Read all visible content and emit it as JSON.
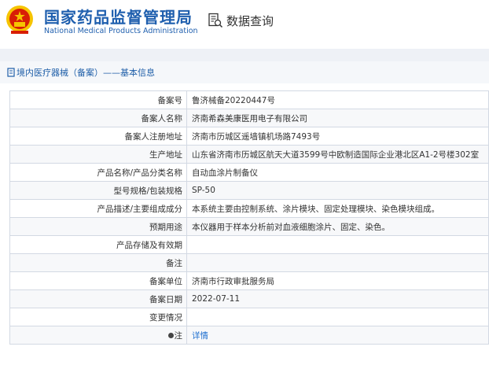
{
  "header": {
    "org_name_cn": "国家药品监督管理局",
    "org_name_en": "National Medical Products Administration",
    "search_title": "数据查询"
  },
  "breadcrumb": {
    "text": "境内医疗器械（备案）——基本信息"
  },
  "record": {
    "rows": [
      {
        "label": "备案号",
        "value": "鲁济械备20220447号"
      },
      {
        "label": "备案人名称",
        "value": "济南希森美康医用电子有限公司"
      },
      {
        "label": "备案人注册地址",
        "value": "济南市历城区遥墙镇机场路7493号"
      },
      {
        "label": "生产地址",
        "value": "山东省济南市历城区航天大道3599号中欧制造国际企业港北区A1-2号楼302室"
      },
      {
        "label": "产品名称/产品分类名称",
        "value": "自动血涂片制备仪"
      },
      {
        "label": "型号规格/包装规格",
        "value": "SP-50"
      },
      {
        "label": "产品描述/主要组成成分",
        "value": "本系统主要由控制系统、涂片模块、固定处理模块、染色模块组成。"
      },
      {
        "label": "预期用途",
        "value": "本仪器用于样本分析前对血液细胞涂片、固定、染色。"
      },
      {
        "label": "产品存储及有效期",
        "value": ""
      },
      {
        "label": "备注",
        "value": ""
      },
      {
        "label": "备案单位",
        "value": "济南市行政审批服务局"
      },
      {
        "label": "备案日期",
        "value": "2022-07-11"
      },
      {
        "label": "变更情况",
        "value": ""
      }
    ],
    "note_label": "注",
    "detail_link": "详情"
  },
  "colors": {
    "brand_blue": "#1f5fae",
    "emblem_red": "#d81e06",
    "emblem_gold": "#f6c400",
    "link": "#1e6fd0"
  }
}
